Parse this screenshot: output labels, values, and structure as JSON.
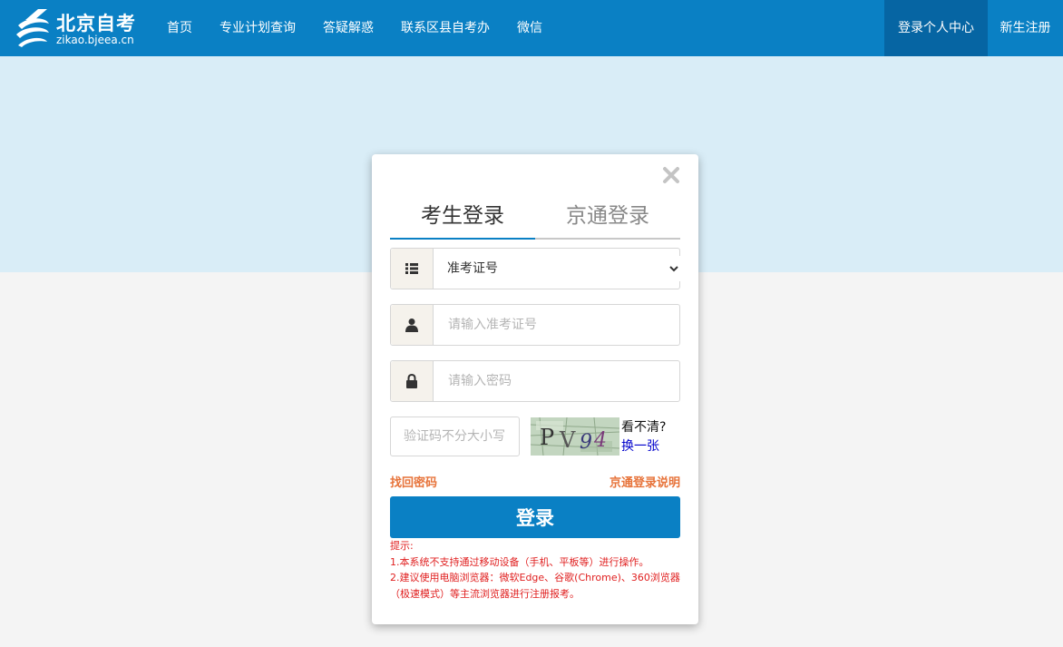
{
  "header": {
    "logo_title": "北京自考",
    "logo_url": "zikao.bjeea.cn",
    "nav": [
      {
        "label": "首页"
      },
      {
        "label": "专业计划查询"
      },
      {
        "label": "答疑解惑"
      },
      {
        "label": "联系区县自考办"
      },
      {
        "label": "微信"
      }
    ],
    "login_center": "登录个人中心",
    "register": "新生注册",
    "colors": {
      "nav_bg": "#0a80c4",
      "active_bg": "#0665a3",
      "banner_bg": "#d9edf7"
    }
  },
  "dialog": {
    "close_icon": "close-icon",
    "tabs": [
      {
        "label": "考生登录",
        "active": true
      },
      {
        "label": "京通登录",
        "active": false
      }
    ],
    "id_type": {
      "icon": "list-icon",
      "selected": "准考证号"
    },
    "id_field": {
      "icon": "user-icon",
      "value": "",
      "placeholder": "请输入准考证号"
    },
    "password_field": {
      "icon": "lock-icon",
      "value": "",
      "placeholder": "请输入密码"
    },
    "captcha": {
      "value": "",
      "placeholder": "验证码不分大小写",
      "image_text": "PV94",
      "hint": "看不清?",
      "refresh": "换一张"
    },
    "find_password": "找回密码",
    "jingtong_help": "京通登录说明",
    "login_button": "登录",
    "tips": {
      "title": "提示:",
      "lines": [
        "1.本系统不支持通过移动设备（手机、平板等）进行操作。",
        "2.建议使用电脑浏览器：微软Edge、谷歌(Chrome)、360浏览器（极速模式）等主流浏览器进行注册报考。"
      ]
    },
    "colors": {
      "accent": "#0a80c4",
      "link": "#e7733a",
      "tip": "#e02020"
    }
  }
}
